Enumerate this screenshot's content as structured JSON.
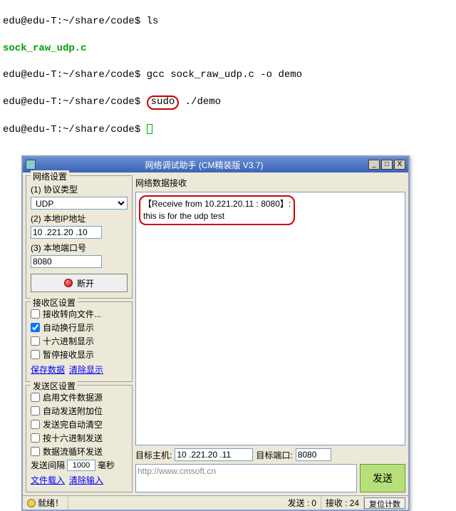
{
  "terminal": {
    "lines": [
      {
        "prompt": "edu@edu-T:~/share/code$ ",
        "cmd": "ls"
      },
      {
        "file": "sock_raw_udp.c"
      },
      {
        "prompt": "edu@edu-T:~/share/code$ ",
        "cmd": "gcc sock_raw_udp.c -o demo"
      },
      {
        "prompt": "edu@edu-T:~/share/code$ ",
        "sudo": "sudo",
        "rest": " ./demo"
      },
      {
        "prompt": "edu@edu-T:~/share/code$ ",
        "cursor": true
      }
    ]
  },
  "app": {
    "title": "网络调试助手 (CM精装版 V3.7)",
    "win_min": "_",
    "win_max": "□",
    "win_close": "X",
    "network_settings": {
      "legend": "网络设置",
      "proto_label": "(1) 协议类型",
      "proto_value": "UDP",
      "ip_label": "(2) 本地IP地址",
      "ip_value": "10 .221.20 .10",
      "port_label": "(3) 本地端口号",
      "port_value": "8080",
      "disconnect": "断开"
    },
    "recv_settings": {
      "legend": "接收区设置",
      "opts": [
        {
          "label": "接收转向文件...",
          "checked": false
        },
        {
          "label": "自动换行显示",
          "checked": true
        },
        {
          "label": "十六进制显示",
          "checked": false
        },
        {
          "label": "暂停接收显示",
          "checked": false
        }
      ],
      "link_save": "保存数据",
      "link_clear": "清除显示"
    },
    "send_settings": {
      "legend": "发送区设置",
      "opts": [
        {
          "label": "启用文件数据源",
          "checked": false
        },
        {
          "label": "自动发送附加位",
          "checked": false
        },
        {
          "label": "发送完自动清空",
          "checked": false
        },
        {
          "label": "按十六进制发送",
          "checked": false
        },
        {
          "label": "数据流循环发送",
          "checked": false
        }
      ],
      "interval_label_pre": "发送间隔",
      "interval_value": "1000",
      "interval_label_post": "毫秒",
      "link_load": "文件载入",
      "link_clear": "清除输入"
    },
    "recv_area": {
      "label": "网络数据接收",
      "line1": "【Receive from 10.221.20.11 : 8080】:",
      "line2": "this is for the udp test"
    },
    "send_area": {
      "host_label": "目标主机:",
      "host_value": "10 .221.20 .11",
      "port_label": "目标端口:",
      "port_value": "8080",
      "input_placeholder": "http://www.cmsoft.cn",
      "send_btn": "发送"
    },
    "status": {
      "ready": "就绪！",
      "send_label": "发送 :",
      "send_count": "0",
      "recv_label": "接收 :",
      "recv_count": "24",
      "reset": "复位计数"
    }
  }
}
